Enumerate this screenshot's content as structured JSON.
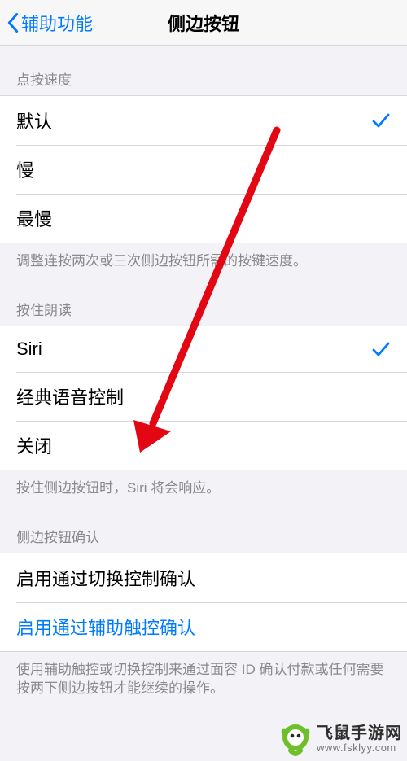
{
  "header": {
    "back_label": "辅助功能",
    "title": "侧边按钮"
  },
  "sections": {
    "speed": {
      "header": "点按速度",
      "options": {
        "default": "默认",
        "slow": "慢",
        "slowest": "最慢"
      },
      "selected": "default",
      "footer": "调整连按两次或三次侧边按钮所需的按键速度。"
    },
    "hold": {
      "header": "按住朗读",
      "options": {
        "siri": "Siri",
        "classic": "经典语音控制",
        "off": "关闭"
      },
      "selected": "siri",
      "footer": "按住侧边按钮时，Siri 将会响应。"
    },
    "confirm": {
      "header": "侧边按钮确认",
      "items": {
        "switch_control": "启用通过切换控制确认",
        "assistive_touch": "启用通过辅助触控确认"
      },
      "footer": "使用辅助触控或切换控制来通过面容 ID 确认付款或任何需要按两下侧边按钮才能继续的操作。"
    }
  },
  "watermark": {
    "line1": "飞鼠手游网",
    "line2": "www.fsklyy.com"
  },
  "colors": {
    "tint": "#007AFF",
    "arrow": "#E30613"
  }
}
